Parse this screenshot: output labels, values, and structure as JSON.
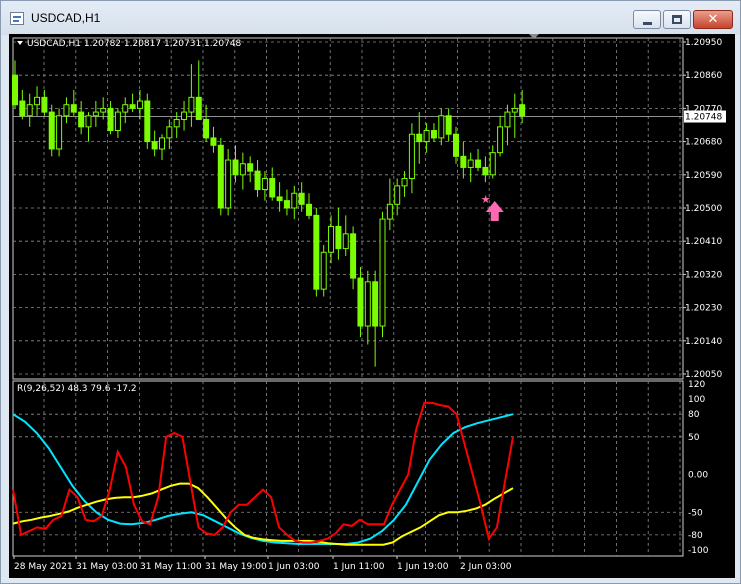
{
  "window": {
    "title": "USDCAD,H1"
  },
  "main": {
    "symbol_label": "USDCAD,H1",
    "ohlc": "1.20782 1.20817 1.20731 1.20748",
    "price_ticks": [
      "1.20950",
      "1.20860",
      "1.20770",
      "1.20680",
      "1.20590",
      "1.20500",
      "1.20410",
      "1.20320",
      "1.20230",
      "1.20140",
      "1.20050"
    ],
    "current_price": "1.20748"
  },
  "indicator": {
    "label": "R(9,26,52) 48.3 79.6 -17.2",
    "ticks": [
      "120",
      "100",
      "80",
      "50",
      "0.00",
      "-50",
      "-80",
      "-100"
    ]
  },
  "time_axis": [
    "28 May 2021",
    "31 May 03:00",
    "31 May 11:00",
    "31 May 19:00",
    "1 Jun 03:00",
    "1 Jun 11:00",
    "1 Jun 19:00",
    "2 Jun 03:00"
  ],
  "colors": {
    "background": "#000000",
    "grid": "#8c8c8c",
    "candle": "#7cfc00",
    "text": "#ffffff",
    "line_fast": "#ff0000",
    "line_mid": "#ffff00",
    "line_slow": "#00e5ff",
    "arrow": "#ff69b4"
  },
  "chart_data": {
    "type": "candlestick",
    "note_current_price": 1.20748,
    "y_range": [
      1.2005,
      1.2095
    ],
    "candles": [
      [
        1.2086,
        1.209,
        1.2077,
        1.2078
      ],
      [
        1.2079,
        1.2082,
        1.2074,
        1.2075
      ],
      [
        1.2075,
        1.2081,
        1.2072,
        1.2078
      ],
      [
        1.2078,
        1.2083,
        1.2075,
        1.208
      ],
      [
        1.208,
        1.2082,
        1.2075,
        1.2076
      ],
      [
        1.2076,
        1.2078,
        1.2064,
        1.2066
      ],
      [
        1.2066,
        1.2077,
        1.2064,
        1.2075
      ],
      [
        1.2075,
        1.208,
        1.2073,
        1.2078
      ],
      [
        1.2078,
        1.2082,
        1.2075,
        1.2076
      ],
      [
        1.2076,
        1.2079,
        1.207,
        1.2072
      ],
      [
        1.2072,
        1.2076,
        1.2068,
        1.2075
      ],
      [
        1.2075,
        1.2079,
        1.2072,
        1.2076
      ],
      [
        1.2076,
        1.208,
        1.2074,
        1.2077
      ],
      [
        1.2077,
        1.2079,
        1.207,
        1.2071
      ],
      [
        1.2071,
        1.2077,
        1.2069,
        1.2076
      ],
      [
        1.2076,
        1.208,
        1.2073,
        1.2078
      ],
      [
        1.2078,
        1.2081,
        1.2076,
        1.2077
      ],
      [
        1.2077,
        1.2082,
        1.2074,
        1.2079
      ],
      [
        1.2079,
        1.2081,
        1.2066,
        1.2068
      ],
      [
        1.2068,
        1.2071,
        1.2064,
        1.2066
      ],
      [
        1.2066,
        1.207,
        1.2063,
        1.2069
      ],
      [
        1.2069,
        1.2074,
        1.2066,
        1.2072
      ],
      [
        1.2072,
        1.2076,
        1.2069,
        1.2074
      ],
      [
        1.2074,
        1.2079,
        1.2071,
        1.2076
      ],
      [
        1.2076,
        1.2089,
        1.2072,
        1.208
      ],
      [
        1.208,
        1.209,
        1.2075,
        1.2074
      ],
      [
        1.2074,
        1.2078,
        1.2068,
        1.2069
      ],
      [
        1.2069,
        1.2072,
        1.2065,
        1.2067
      ],
      [
        1.2067,
        1.2069,
        1.2048,
        1.205
      ],
      [
        1.205,
        1.2066,
        1.2048,
        1.2063
      ],
      [
        1.2063,
        1.2067,
        1.2057,
        1.2059
      ],
      [
        1.2059,
        1.2065,
        1.2055,
        1.2062
      ],
      [
        1.2062,
        1.2064,
        1.2057,
        1.206
      ],
      [
        1.206,
        1.2063,
        1.2053,
        1.2055
      ],
      [
        1.2055,
        1.206,
        1.2052,
        1.2058
      ],
      [
        1.2058,
        1.2061,
        1.2052,
        1.2053
      ],
      [
        1.2053,
        1.2057,
        1.2049,
        1.2052
      ],
      [
        1.2052,
        1.2055,
        1.2048,
        1.205
      ],
      [
        1.205,
        1.2056,
        1.2047,
        1.2054
      ],
      [
        1.2054,
        1.2057,
        1.2049,
        1.2051
      ],
      [
        1.2051,
        1.2054,
        1.2047,
        1.2048
      ],
      [
        1.2048,
        1.205,
        1.2026,
        1.2028
      ],
      [
        1.2028,
        1.204,
        1.2026,
        1.2038
      ],
      [
        1.2038,
        1.2048,
        1.2035,
        1.2045
      ],
      [
        1.2045,
        1.205,
        1.2036,
        1.2039
      ],
      [
        1.2039,
        1.2048,
        1.2037,
        1.2043
      ],
      [
        1.2043,
        1.2045,
        1.2028,
        1.2031
      ],
      [
        1.2031,
        1.2034,
        1.2015,
        1.2018
      ],
      [
        1.2018,
        1.2033,
        1.2013,
        1.203
      ],
      [
        1.203,
        1.2033,
        1.2007,
        1.2018
      ],
      [
        1.2018,
        1.2049,
        1.2015,
        1.2047
      ],
      [
        1.2047,
        1.2058,
        1.2044,
        1.2051
      ],
      [
        1.2051,
        1.2058,
        1.2048,
        1.2056
      ],
      [
        1.2056,
        1.206,
        1.2053,
        1.2058
      ],
      [
        1.2058,
        1.2073,
        1.2054,
        1.207
      ],
      [
        1.207,
        1.2076,
        1.2062,
        1.2068
      ],
      [
        1.2068,
        1.2073,
        1.2065,
        1.2071
      ],
      [
        1.2071,
        1.2073,
        1.2068,
        1.2069
      ],
      [
        1.2069,
        1.2077,
        1.2067,
        1.2075
      ],
      [
        1.2075,
        1.2077,
        1.2068,
        1.207
      ],
      [
        1.207,
        1.2072,
        1.2062,
        1.2064
      ],
      [
        1.2064,
        1.2068,
        1.2058,
        1.2061
      ],
      [
        1.2061,
        1.2065,
        1.2057,
        1.2063
      ],
      [
        1.2063,
        1.2066,
        1.206,
        1.2061
      ],
      [
        1.2061,
        1.2064,
        1.2057,
        1.2059
      ],
      [
        1.2059,
        1.2067,
        1.2058,
        1.2065
      ],
      [
        1.2065,
        1.2075,
        1.2064,
        1.2072
      ],
      [
        1.2072,
        1.2078,
        1.2067,
        1.2076
      ],
      [
        1.2076,
        1.2081,
        1.2069,
        1.2077
      ],
      [
        1.2078,
        1.2082,
        1.2073,
        1.2075
      ]
    ],
    "indicator": {
      "y_range": [
        -100,
        120
      ],
      "red": [
        -20,
        -80,
        -75,
        -70,
        -72,
        -60,
        -55,
        -20,
        -30,
        -60,
        -62,
        -55,
        -20,
        30,
        10,
        -40,
        -62,
        -66,
        -30,
        50,
        55,
        50,
        -10,
        -70,
        -78,
        -80,
        -70,
        -50,
        -40,
        -40,
        -30,
        -20,
        -30,
        -70,
        -80,
        -88,
        -90,
        -90,
        -88,
        -85,
        -78,
        -66,
        -68,
        -60,
        -66,
        -66,
        -66,
        -40,
        -20,
        0,
        60,
        95,
        95,
        92,
        90,
        80,
        40,
        0,
        -40,
        -85,
        -70,
        -10,
        50
      ],
      "yellow": [
        -65,
        -62,
        -60,
        -57,
        -55,
        -52,
        -49,
        -44,
        -40,
        -36,
        -33,
        -31,
        -30,
        -30,
        -28,
        -25,
        -20,
        -15,
        -12,
        -12,
        -18,
        -30,
        -44,
        -58,
        -70,
        -80,
        -84,
        -86,
        -87,
        -88,
        -88,
        -88,
        -88,
        -89,
        -91,
        -92,
        -93,
        -93,
        -93,
        -93,
        -93,
        -90,
        -82,
        -76,
        -70,
        -62,
        -54,
        -50,
        -50,
        -48,
        -45,
        -40,
        -32,
        -25,
        -18
      ],
      "cyan": [
        80,
        70,
        55,
        35,
        10,
        -15,
        -35,
        -50,
        -60,
        -65,
        -66,
        -64,
        -60,
        -55,
        -52,
        -50,
        -54,
        -62,
        -70,
        -78,
        -84,
        -88,
        -90,
        -91,
        -92,
        -92,
        -92,
        -92,
        -92,
        -90,
        -85,
        -75,
        -60,
        -40,
        -10,
        20,
        40,
        55,
        63,
        68,
        72,
        76,
        80
      ]
    }
  }
}
